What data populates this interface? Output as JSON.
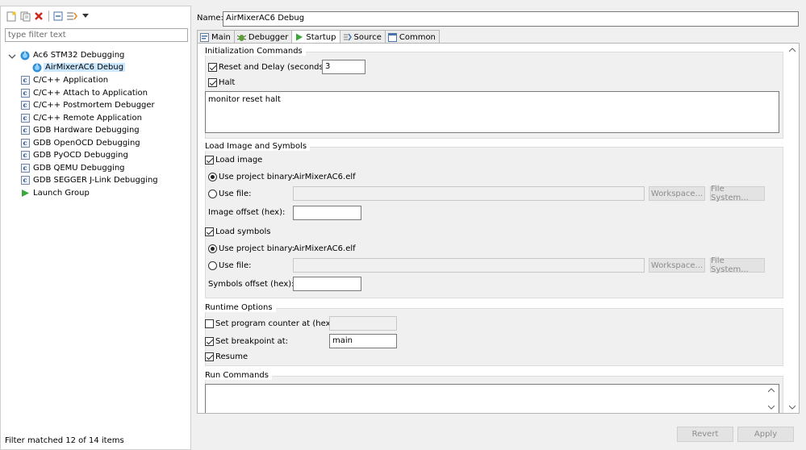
{
  "window": {
    "title": ""
  },
  "sidebar": {
    "toolbar": [
      {
        "icon": "new-configuration-icon"
      },
      {
        "icon": "duplicate-icon"
      },
      {
        "icon": "delete-icon"
      },
      {
        "icon": "collapse-all-icon"
      },
      {
        "icon": "filter-icon"
      },
      {
        "icon": "view-menu-icon"
      }
    ],
    "filter_placeholder": "type filter text",
    "tree": [
      {
        "label": "Ac6 STM32 Debugging",
        "icon": "ac6-debug-icon",
        "expanded": true
      },
      {
        "label": "AirMixerAC6 Debug",
        "icon": "ac6-debug-icon",
        "selected": true,
        "child": true
      },
      {
        "label": "C/C++ Application",
        "icon": "c-file-icon"
      },
      {
        "label": "C/C++ Attach to Application",
        "icon": "c-file-icon"
      },
      {
        "label": "C/C++ Postmortem Debugger",
        "icon": "c-file-icon"
      },
      {
        "label": "C/C++ Remote Application",
        "icon": "c-file-icon"
      },
      {
        "label": "GDB Hardware Debugging",
        "icon": "c-file-icon"
      },
      {
        "label": "GDB OpenOCD Debugging",
        "icon": "c-file-icon"
      },
      {
        "label": "GDB PyOCD Debugging",
        "icon": "c-file-icon"
      },
      {
        "label": "GDB QEMU Debugging",
        "icon": "c-file-icon"
      },
      {
        "label": "GDB SEGGER J-Link Debugging",
        "icon": "c-file-icon"
      },
      {
        "label": "Launch Group",
        "icon": "launch-group-icon"
      }
    ],
    "status": "Filter matched 12 of 14 items"
  },
  "config": {
    "name_label": "Name:",
    "name_value": "AirMixerAC6 Debug",
    "tabs": [
      {
        "label": "Main",
        "icon": "main-tab-icon"
      },
      {
        "label": "Debugger",
        "icon": "debugger-tab-icon"
      },
      {
        "label": "Startup",
        "icon": "startup-tab-icon",
        "active": true
      },
      {
        "label": "Source",
        "icon": "source-tab-icon"
      },
      {
        "label": "Common",
        "icon": "common-tab-icon"
      }
    ]
  },
  "startup": {
    "init": {
      "title": "Initialization Commands",
      "reset_label": "Reset and Delay (seconds):",
      "reset_checked": true,
      "delay_value": "3",
      "halt_label": "Halt",
      "halt_checked": true,
      "commands": "monitor reset halt"
    },
    "load": {
      "title": "Load Image and Symbols",
      "load_image_label": "Load image",
      "load_image_checked": true,
      "use_project_binary_label": "Use project binary:",
      "image_binary": "AirMixerAC6.elf",
      "use_file_label": "Use file:",
      "workspace_label": "Workspace...",
      "filesystem_label": "File System...",
      "image_offset_label": "Image offset (hex):",
      "image_offset_value": "",
      "load_symbols_label": "Load symbols",
      "load_symbols_checked": true,
      "symbols_binary": "AirMixerAC6.elf",
      "symbols_offset_label": "Symbols offset (hex):",
      "symbols_offset_value": ""
    },
    "runtime": {
      "title": "Runtime Options",
      "set_pc_label": "Set program counter at (hex):",
      "set_pc_checked": false,
      "set_pc_value": "",
      "set_bp_label": "Set breakpoint at:",
      "set_bp_checked": true,
      "set_bp_value": "main",
      "resume_label": "Resume",
      "resume_checked": true
    },
    "run": {
      "title": "Run Commands",
      "commands": ""
    }
  },
  "footer": {
    "revert_label": "Revert",
    "apply_label": "Apply"
  },
  "colors": {
    "selection": "#cce8ff",
    "background": "#f0f0f0",
    "disabled_text": "#8c8c8c"
  }
}
